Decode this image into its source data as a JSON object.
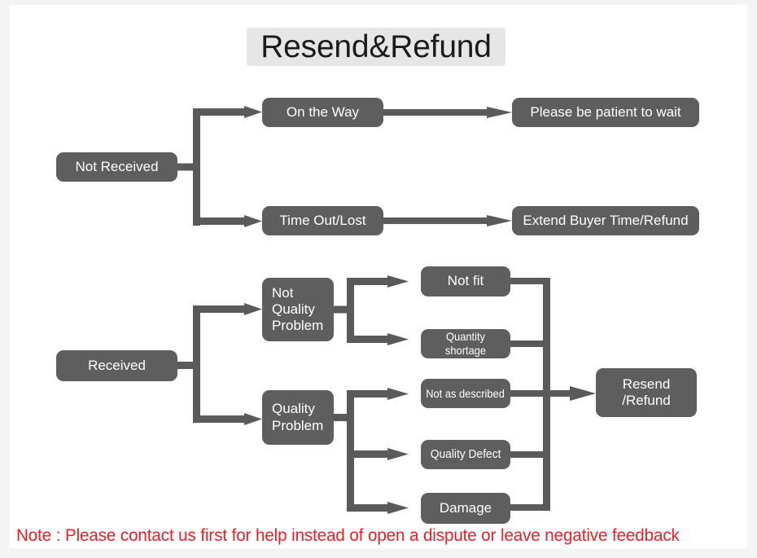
{
  "title": "Resend&Refund",
  "colors": {
    "node_fill": "#5e5e5e",
    "node_text": "#ffffff",
    "connector": "#5a5a5a",
    "title_background": "#e6e6e6",
    "note_text": "#ee1c25",
    "canvas_background": "#ffffff"
  },
  "flow": {
    "not_received": {
      "label": "Not Received",
      "branches": [
        {
          "label": "On the Way",
          "outcome": "Please be patient to wait"
        },
        {
          "label": "Time Out/Lost",
          "outcome": "Extend Buyer Time/Refund"
        }
      ]
    },
    "received": {
      "label": "Received",
      "branches": [
        {
          "label_lines": [
            "Not",
            "Quality",
            "Problem"
          ],
          "reasons": [
            "Not fit",
            "Quantity shortage"
          ]
        },
        {
          "label_lines": [
            "Quality",
            "Problem"
          ],
          "reasons": [
            "Not as described",
            "Quality Defect",
            "Damage"
          ]
        }
      ],
      "outcome_lines": [
        "Resend",
        "/Refund"
      ]
    }
  },
  "nodes": {
    "not_received": "Not Received",
    "on_the_way": "On the Way",
    "time_out_lost": "Time Out/Lost",
    "please_be_patient": "Please be patient to wait",
    "extend_buyer": "Extend Buyer Time/Refund",
    "received": "Received",
    "not_quality_l1": "Not",
    "not_quality_l2": "Quality",
    "not_quality_l3": "Problem",
    "quality_l1": "Quality",
    "quality_l2": "Problem",
    "not_fit": "Not fit",
    "quantity_shortage": "Quantity shortage",
    "not_as_described": "Not as described",
    "quality_defect": "Quality Defect",
    "damage": "Damage",
    "resend_l1": "Resend",
    "resend_l2": "/Refund"
  },
  "note": "Note : Please contact us first for help instead of open a dispute or leave negative feedback"
}
